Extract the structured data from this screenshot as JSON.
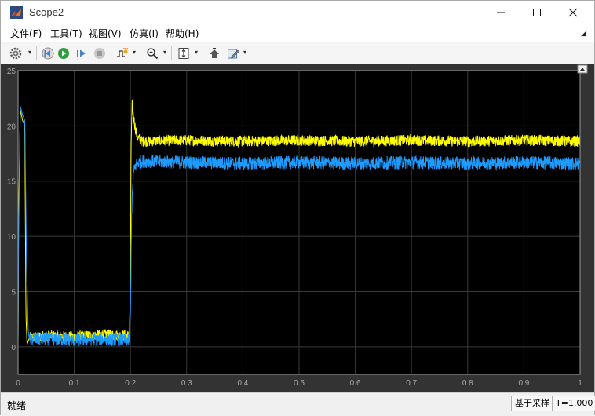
{
  "window": {
    "title": "Scope2"
  },
  "menu": [
    {
      "label": "文件(F)"
    },
    {
      "label": "工具(T)"
    },
    {
      "label": "视图(V)"
    },
    {
      "label": "仿真(I)"
    },
    {
      "label": "帮助(H)"
    }
  ],
  "toolbar": {
    "icons": [
      "settings-gear-icon",
      "step-back-icon",
      "run-icon",
      "step-forward-icon",
      "stop-icon",
      "signal-triggers-icon",
      "zoom-in-icon",
      "autoscale-icon",
      "highlight-simulink-block-icon",
      "edit-properties-icon"
    ]
  },
  "status": {
    "text": "就绪",
    "mode": "基于采样",
    "time": "T=1.000"
  },
  "colors": {
    "series1": "#ffff00",
    "series2": "#1e9bff",
    "background": "#000000",
    "grid": "#3a3a3a",
    "tick": "#a8a8a8"
  },
  "chart_data": {
    "type": "line",
    "xlim": [
      0,
      1
    ],
    "ylim": [
      -2.5,
      25
    ],
    "x_ticks": [
      "0",
      "0.1",
      "0.2",
      "0.3",
      "0.4",
      "0.5",
      "0.6",
      "0.7",
      "0.8",
      "0.9",
      "1"
    ],
    "y_ticks": [
      "0",
      "5",
      "10",
      "15",
      "20",
      "25"
    ],
    "grid": true,
    "series": [
      {
        "color": "#ffff00",
        "x": [
          0,
          0.001,
          0.004,
          0.008,
          0.012,
          0.014,
          0.016,
          0.02,
          0.05,
          0.1,
          0.15,
          0.198,
          0.2,
          0.201,
          0.203,
          0.205,
          0.208,
          0.212,
          0.22,
          0.3,
          0.4,
          0.5,
          0.6,
          0.7,
          0.8,
          0.9,
          1.0
        ],
        "y": [
          0.5,
          12,
          21.5,
          20.5,
          20.0,
          3,
          0.2,
          0.8,
          1.0,
          0.9,
          1.1,
          1.0,
          5,
          18,
          22,
          21,
          20,
          19,
          18.6,
          18.7,
          18.6,
          18.7,
          18.6,
          18.7,
          18.6,
          18.7,
          18.6
        ],
        "noise": 0.5
      },
      {
        "color": "#1e9bff",
        "x": [
          0,
          0.001,
          0.004,
          0.008,
          0.012,
          0.015,
          0.018,
          0.02,
          0.05,
          0.1,
          0.15,
          0.198,
          0.2,
          0.202,
          0.205,
          0.208,
          0.212,
          0.22,
          0.3,
          0.4,
          0.5,
          0.6,
          0.7,
          0.8,
          0.9,
          1.0
        ],
        "y": [
          0.3,
          10,
          21.8,
          21.0,
          20.5,
          8,
          1.5,
          0.7,
          0.7,
          0.6,
          0.7,
          0.6,
          3,
          12,
          15.5,
          16.3,
          16.6,
          16.8,
          16.7,
          16.6,
          16.7,
          16.6,
          16.7,
          16.6,
          16.7,
          16.6
        ],
        "noise": 0.6
      }
    ]
  }
}
